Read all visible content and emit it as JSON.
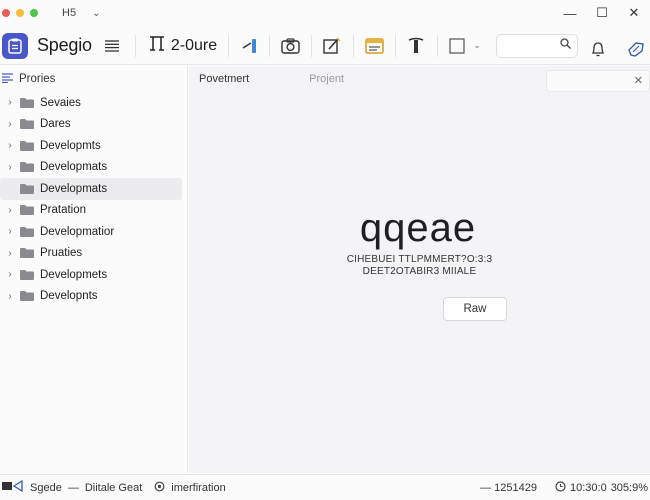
{
  "window": {
    "title": "H5",
    "chevron": "⌄",
    "controls": [
      "—",
      "☐",
      "✕"
    ]
  },
  "toolbar": {
    "app_name": "Spegio",
    "structure_label": "2-0ure",
    "search_placeholder": "",
    "icons": [
      "list-icon",
      "structure-icon",
      "ruler-icon",
      "camera-icon",
      "edit-icon",
      "calendar-icon",
      "format-icon",
      "square-icon",
      "search-icon",
      "bell-icon",
      "tag-icon"
    ]
  },
  "sidebar": {
    "header": "Prories",
    "items": [
      {
        "label": "Sevaies",
        "expandable": true,
        "selected": false
      },
      {
        "label": "Dares",
        "expandable": true,
        "selected": false
      },
      {
        "label": "Developmts",
        "expandable": true,
        "selected": false
      },
      {
        "label": "Developmats",
        "expandable": true,
        "selected": false
      },
      {
        "label": "Developmats",
        "expandable": false,
        "selected": true
      },
      {
        "label": "Pratation",
        "expandable": true,
        "selected": false
      },
      {
        "label": "Developmatior",
        "expandable": true,
        "selected": false
      },
      {
        "label": "Pruaties",
        "expandable": true,
        "selected": false
      },
      {
        "label": "Developmets",
        "expandable": true,
        "selected": false
      },
      {
        "label": "Developnts",
        "expandable": true,
        "selected": false
      }
    ]
  },
  "main": {
    "tabs": [
      {
        "label": "Povetmert",
        "active": true
      },
      {
        "label": "Projent",
        "active": false
      }
    ],
    "search_value": "",
    "hero_title": "qqeae",
    "hero_line1": "CIHEBUEI TTLPMMERT?O:3:3",
    "hero_line2": "DEET2OTABIR3 MIIALE",
    "hero_button": "Raw"
  },
  "statusbar": {
    "app": "Sgede",
    "doc": "Diitale Geat",
    "info": "imerfiration",
    "count": "1251429",
    "time": "10:30:0",
    "zoom": "305:9%"
  },
  "colors": {
    "accent": "#4a57c8",
    "folder": "#8a8a90",
    "calendar_accent": "#e6b23a"
  }
}
